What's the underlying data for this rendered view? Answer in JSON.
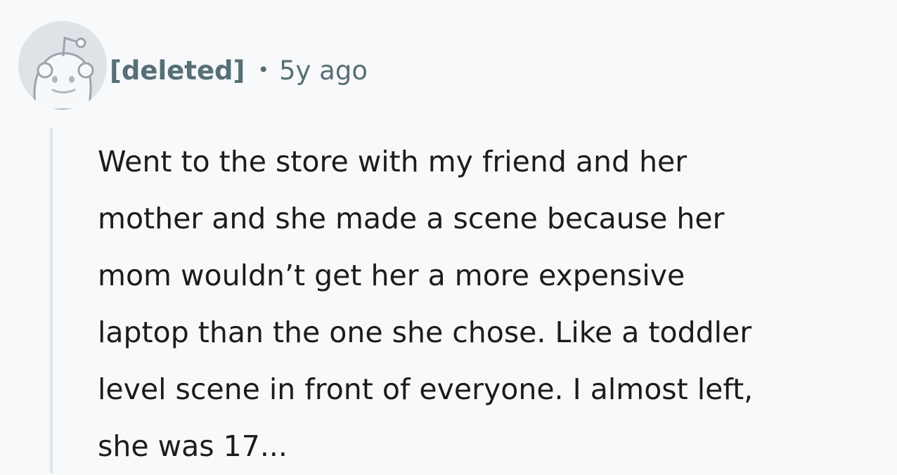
{
  "comment": {
    "author": "[deleted]",
    "separator": "•",
    "timestamp": "5y ago",
    "avatar_icon": "reddit-snoo-deleted-avatar",
    "body_lines": [
      "Went to the store with my friend and her",
      "mother and she made a scene because her",
      "mom wouldn’t get her a more expensive",
      "laptop than the one she chose. Like a toddler",
      "level scene in front of everyone. I almost left,",
      "she was 17..."
    ]
  },
  "colors": {
    "background": "#f8f9fa",
    "meta_text": "#576f76",
    "thread_line": "#dbe6ee",
    "body_text": "#1c1c1c"
  }
}
